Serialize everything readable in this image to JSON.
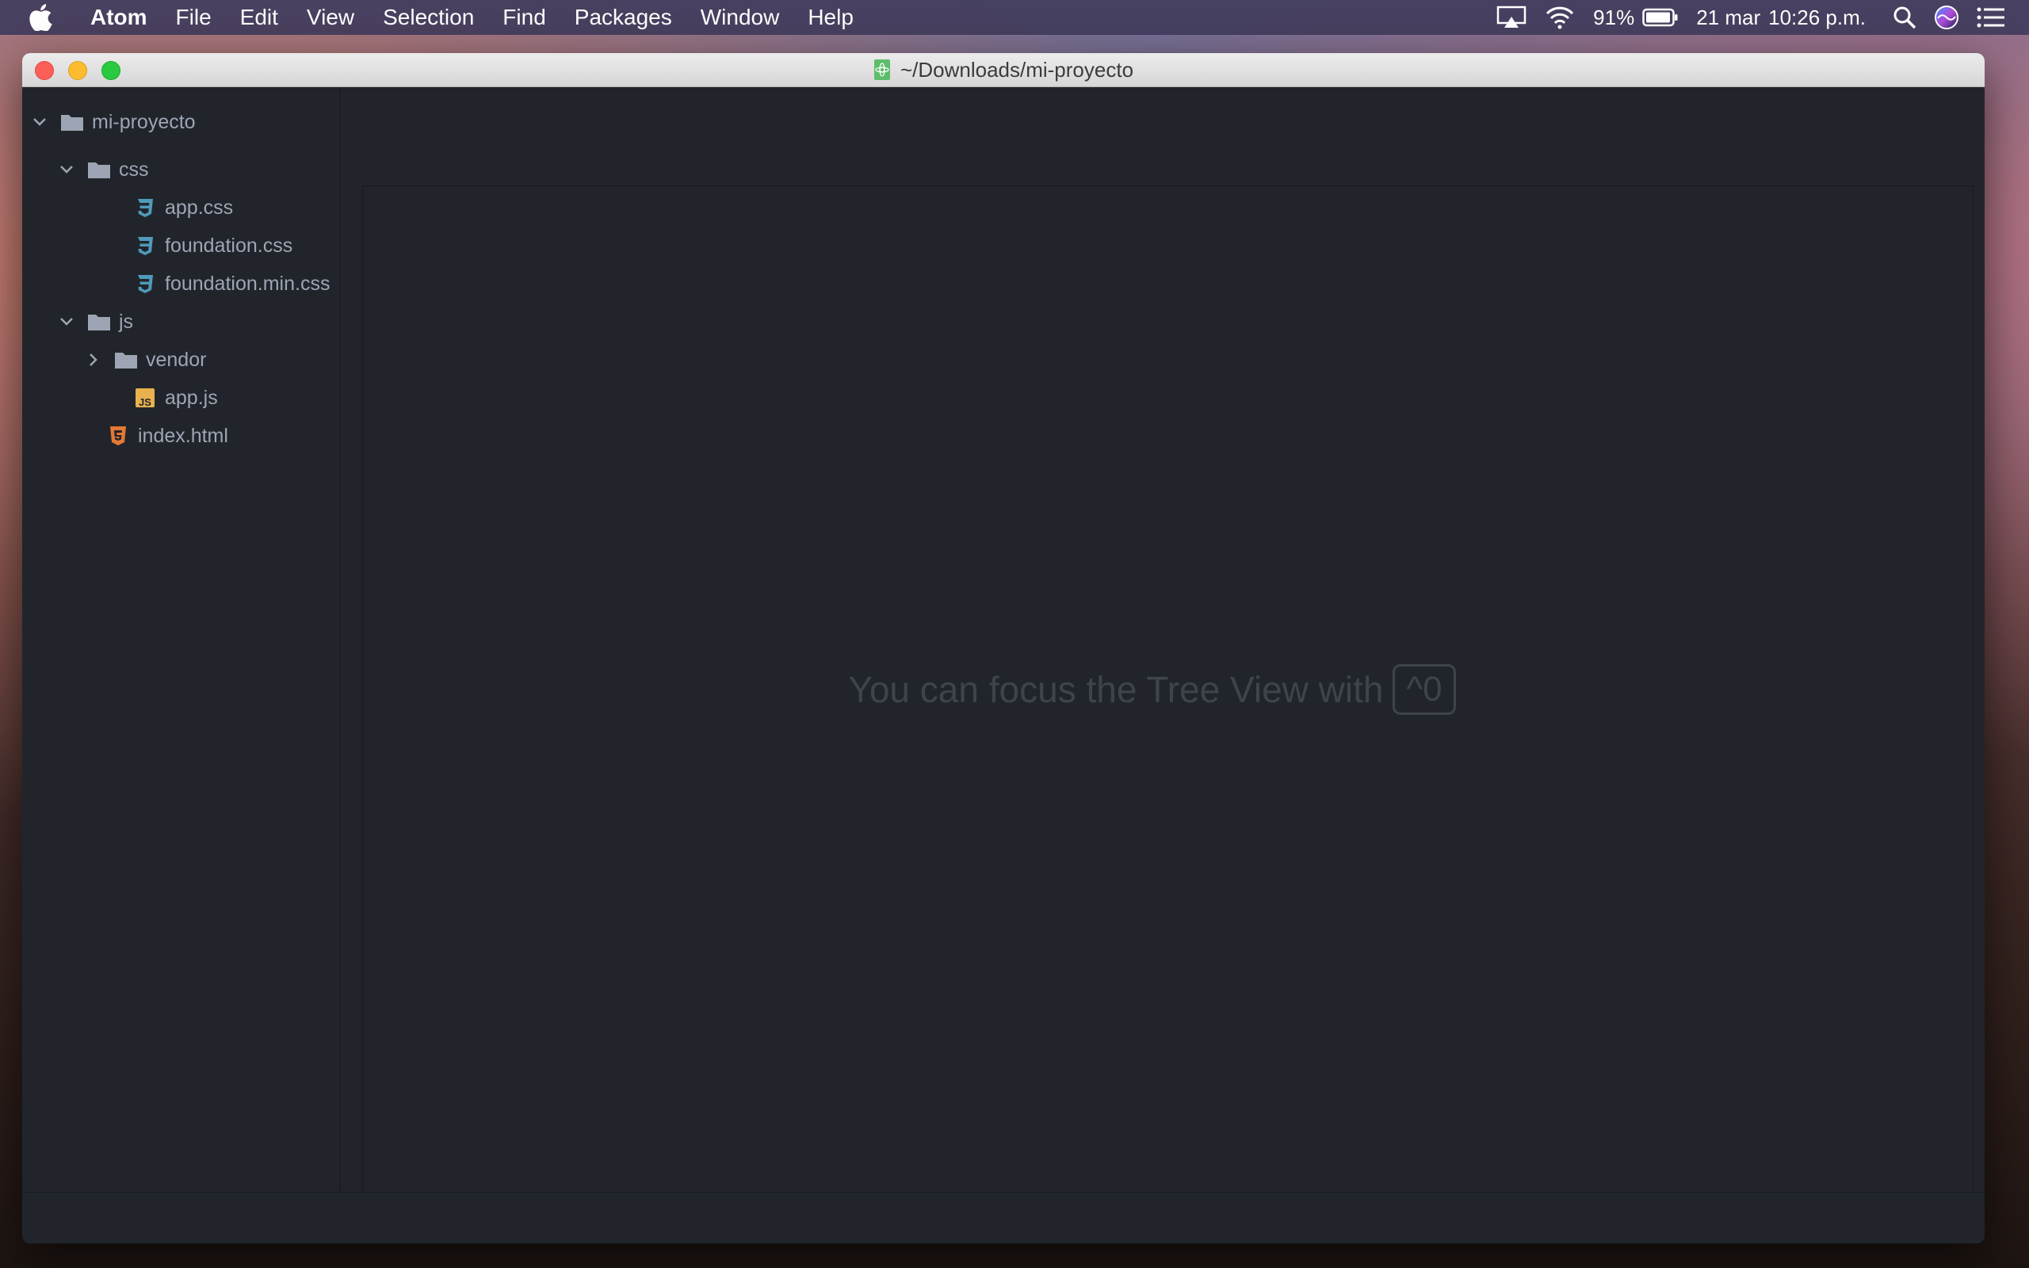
{
  "menubar": {
    "app_name": "Atom",
    "items": [
      "File",
      "Edit",
      "View",
      "Selection",
      "Find",
      "Packages",
      "Window",
      "Help"
    ],
    "battery": "91%",
    "date": "21 mar",
    "time": "10:26 p.m."
  },
  "window": {
    "title": "~/Downloads/mi-proyecto"
  },
  "tree": {
    "root": "mi-proyecto",
    "css_folder": "css",
    "css_files": [
      "app.css",
      "foundation.css",
      "foundation.min.css"
    ],
    "js_folder": "js",
    "vendor_folder": "vendor",
    "js_file": "app.js",
    "html_file": "index.html"
  },
  "editor": {
    "hint_text": "You can focus the Tree View with",
    "hint_key": "^0"
  },
  "colors": {
    "css_icon": "#519aba",
    "js_icon": "#e8b14e",
    "html_icon": "#e37933",
    "folder_icon": "#9da5b4"
  }
}
